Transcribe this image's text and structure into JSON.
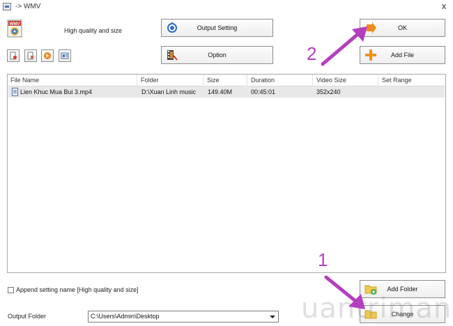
{
  "window": {
    "title": "-> WMV",
    "close_glyph": "x"
  },
  "profile": {
    "badge": "WMV",
    "quality_label": "High quality and size"
  },
  "toolbar": {
    "output_setting_label": "Output Setting",
    "option_label": "Option",
    "ok_label": "OK",
    "add_file_label": "Add File",
    "add_folder_label": "Add Folder",
    "change_label": "Change"
  },
  "file_list": {
    "columns": [
      "File Name",
      "Folder",
      "Size",
      "Duration",
      "Video Size",
      "Set Range"
    ],
    "rows": [
      {
        "file_name": "Lien Khuc Mua Bui 3.mp4",
        "folder": "D:\\Xuan Linh music",
        "size": "149.40M",
        "duration": "00:45:01",
        "video_size": "352x240",
        "set_range": ""
      }
    ]
  },
  "options": {
    "append_setting_label": "Append setting name [High quality and size]",
    "output_folder_label": "Output Folder",
    "output_folder_value": "C:\\Users\\Admin\\Desktop"
  },
  "annotations": {
    "step_1": "1",
    "step_2": "2",
    "arrow_color": "#b33fbf",
    "watermark": "uantrimang"
  },
  "colors": {
    "row_highlight": "#e8e8e8",
    "ok_icon": "#f08a1c",
    "add_icon": "#f0921c"
  },
  "icons": {
    "output_setting": "gear-icon",
    "option": "film-tools-icon",
    "ok": "arrow-right-icon",
    "add_file": "plus-icon",
    "add_folder": "folder-add-icon",
    "change": "folder-icon"
  }
}
